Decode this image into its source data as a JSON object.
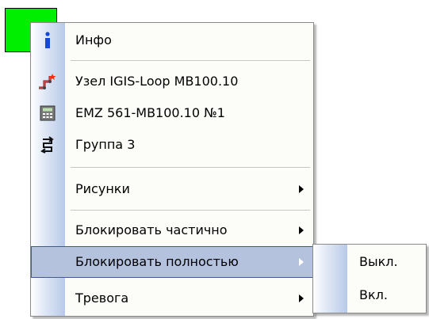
{
  "menu": {
    "items": [
      {
        "label": "Инфо",
        "icon": "info-icon"
      },
      {
        "label": "Узел IGIS-Loop MB100.10",
        "icon": "loop-node-icon"
      },
      {
        "label": "EMZ 561-MB100.10 №1",
        "icon": "device-icon"
      },
      {
        "label": "Группа 3",
        "icon": "group-icon"
      },
      {
        "label": "Рисунки"
      },
      {
        "label": "Блокировать частично"
      },
      {
        "label": "Блокировать полностью"
      },
      {
        "label": "Тревога"
      }
    ]
  },
  "submenu": {
    "items": [
      {
        "label": "Выкл."
      },
      {
        "label": "Вкл."
      }
    ]
  },
  "colors": {
    "green_box": "#00ee00",
    "highlight": "#b4c2de",
    "highlight_border": "#3f5a8c"
  }
}
